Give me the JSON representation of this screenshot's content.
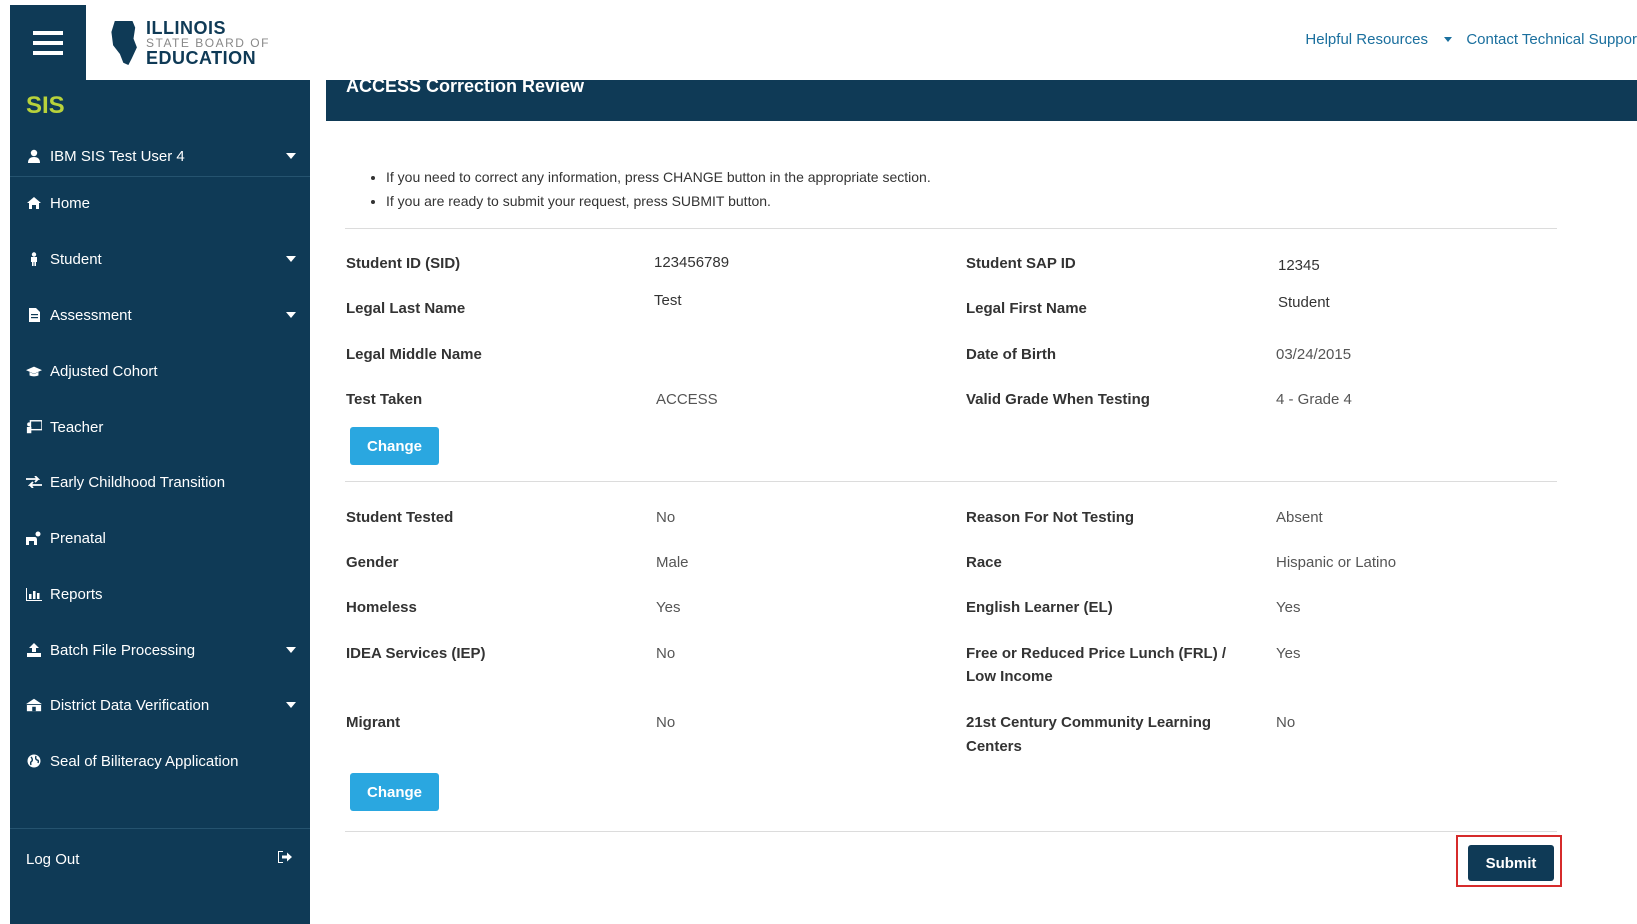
{
  "top_links": {
    "helpful_resources": "Helpful Resources",
    "contact_support": "Contact Technical Suppor"
  },
  "logo": {
    "line1": "ILLINOIS",
    "line2": "STATE BOARD OF",
    "line3": "EDUCATION"
  },
  "sidebar": {
    "app_name": "SIS",
    "user": "IBM SIS Test User 4",
    "items": [
      {
        "label": "Home",
        "icon": "home-icon"
      },
      {
        "label": "Student",
        "icon": "student-icon"
      },
      {
        "label": "Assessment",
        "icon": "document-icon"
      },
      {
        "label": "Adjusted Cohort",
        "icon": "graduation-cap-icon"
      },
      {
        "label": "Teacher",
        "icon": "teacher-icon"
      },
      {
        "label": "Early Childhood Transition",
        "icon": "exchange-icon"
      },
      {
        "label": "Prenatal",
        "icon": "prenatal-icon"
      },
      {
        "label": "Reports",
        "icon": "chart-icon"
      },
      {
        "label": "Batch File Processing",
        "icon": "upload-icon"
      },
      {
        "label": "District Data Verification",
        "icon": "building-icon"
      },
      {
        "label": "Seal of Biliteracy Application",
        "icon": "globe-icon"
      }
    ],
    "logout": "Log Out"
  },
  "page": {
    "title": "ACCESS Correction Review",
    "instructions": [
      "If you need to correct any information, press CHANGE button in the appropriate section.",
      "If you are ready to submit your request, press SUBMIT button."
    ],
    "change_label": "Change",
    "submit_label": "Submit"
  },
  "section1": [
    {
      "label": "Student ID (SID)",
      "value": "123456789"
    },
    {
      "label": "Student SAP ID",
      "value": "12345"
    },
    {
      "label": "Legal Last Name",
      "value": "Test"
    },
    {
      "label": "Legal First Name",
      "value": "Student"
    },
    {
      "label": "Legal Middle Name",
      "value": ""
    },
    {
      "label": "Date of Birth",
      "value": "03/24/2015"
    },
    {
      "label": "Test Taken",
      "value": "ACCESS"
    },
    {
      "label": "Valid Grade When Testing",
      "value": "4 - Grade 4"
    }
  ],
  "section2": [
    {
      "label": "Student Tested",
      "value": "No"
    },
    {
      "label": "Reason For Not Testing",
      "value": "Absent"
    },
    {
      "label": "Gender",
      "value": "Male"
    },
    {
      "label": "Race",
      "value": "Hispanic or Latino"
    },
    {
      "label": "Homeless",
      "value": "Yes"
    },
    {
      "label": "English Learner (EL)",
      "value": "Yes"
    },
    {
      "label": "IDEA Services (IEP)",
      "value": "No"
    },
    {
      "label": "Free or Reduced Price Lunch (FRL) /",
      "label2": "Low Income",
      "value": "Yes"
    },
    {
      "label": "Migrant",
      "value": "No"
    },
    {
      "label": "21st Century Community Learning",
      "label2": "Centers",
      "value": "No"
    }
  ]
}
